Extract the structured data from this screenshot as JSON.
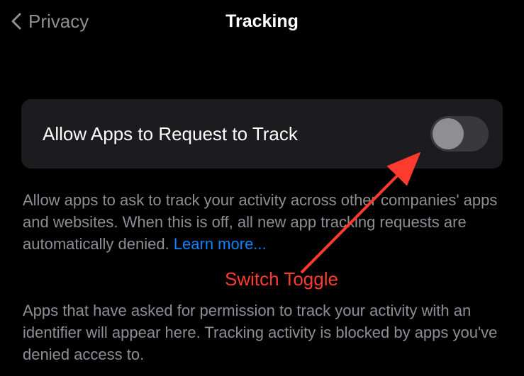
{
  "header": {
    "back_label": "Privacy",
    "title": "Tracking"
  },
  "setting": {
    "label": "Allow Apps to Request to Track",
    "toggle_on": false
  },
  "description1": {
    "text": "Allow apps to ask to track your activity across other companies' apps and websites. When this is off, all new app tracking requests are automatically denied. ",
    "learn_more": "Learn more..."
  },
  "description2": {
    "text": "Apps that have asked for permission to track your activity with an identifier will appear here. Tracking activity is blocked by apps you've denied access to."
  },
  "annotation": {
    "label": "Switch Toggle"
  }
}
